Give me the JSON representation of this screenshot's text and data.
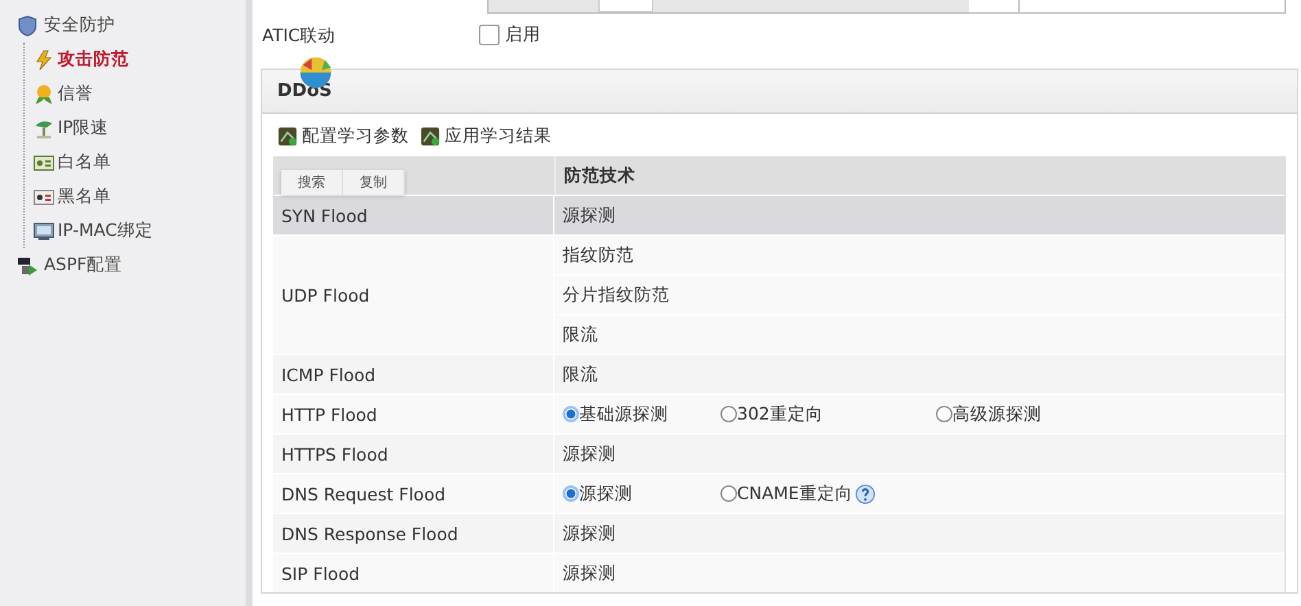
{
  "sidebar": {
    "items": [
      {
        "label": "安全防护",
        "selected": false,
        "children": [
          {
            "label": "攻击防范",
            "selected": true
          },
          {
            "label": "信誉",
            "selected": false
          },
          {
            "label": "IP限速",
            "selected": false
          },
          {
            "label": "白名单",
            "selected": false
          },
          {
            "label": "黑名单",
            "selected": false
          },
          {
            "label": "IP-MAC绑定",
            "selected": false
          }
        ]
      },
      {
        "label": "ASPF配置",
        "selected": false
      }
    ]
  },
  "atic": {
    "label": "ATIC联动",
    "checkbox": {
      "label": "启用",
      "checked": false
    }
  },
  "ddos": {
    "title": "DDoS",
    "toolbar": [
      "配置学习参数",
      "应用学习结果"
    ],
    "table": {
      "column_2": "防范技术",
      "context_menu": [
        "搜索",
        "复制"
      ],
      "rows": [
        {
          "attack": "SYN Flood",
          "selected": true,
          "defenses": [
            {
              "kind": "text",
              "label": "源探测"
            }
          ]
        },
        {
          "attack": "UDP Flood",
          "selected": false,
          "defenses": [
            {
              "kind": "text",
              "label": "指纹防范"
            },
            {
              "kind": "text",
              "label": "分片指纹防范"
            },
            {
              "kind": "text",
              "label": "限流"
            }
          ]
        },
        {
          "attack": "ICMP Flood",
          "selected": false,
          "defenses": [
            {
              "kind": "text",
              "label": "限流"
            }
          ]
        },
        {
          "attack": "HTTP Flood",
          "selected": false,
          "defenses": [
            {
              "kind": "radio",
              "options": [
                {
                  "label": "基础源探测",
                  "selected": true
                },
                {
                  "label": "302重定向",
                  "selected": false
                },
                {
                  "label": "高级源探测",
                  "selected": false
                }
              ]
            }
          ]
        },
        {
          "attack": "HTTPS Flood",
          "selected": false,
          "defenses": [
            {
              "kind": "text",
              "label": "源探测"
            }
          ]
        },
        {
          "attack": "DNS Request Flood",
          "selected": false,
          "defenses": [
            {
              "kind": "radio",
              "help": true,
              "options": [
                {
                  "label": "源探测",
                  "selected": true
                },
                {
                  "label": "CNAME重定向",
                  "selected": false
                }
              ]
            }
          ]
        },
        {
          "attack": "DNS Response Flood",
          "selected": false,
          "defenses": [
            {
              "kind": "text",
              "label": "源探测"
            }
          ]
        },
        {
          "attack": "SIP Flood",
          "selected": false,
          "defenses": [
            {
              "kind": "text",
              "label": "源探测"
            }
          ]
        }
      ]
    }
  }
}
